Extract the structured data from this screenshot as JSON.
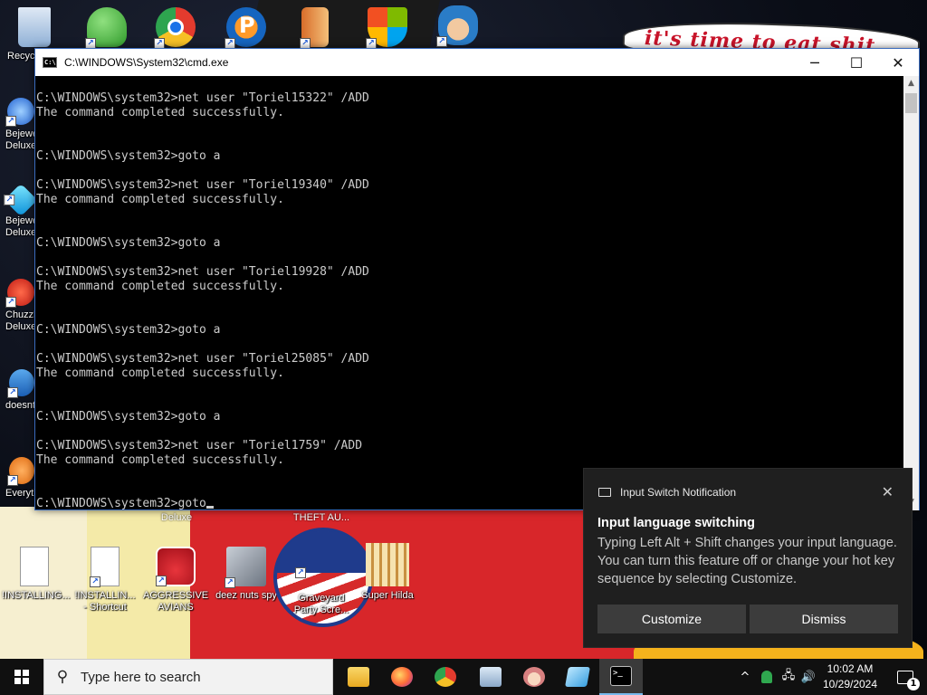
{
  "desktop": {
    "banner_text": "it's time to eat shit",
    "icons": [
      {
        "label": "Recycle Bin",
        "icon": "recycle-bin-icon",
        "color": "#7fa7d8"
      },
      {
        "label": "",
        "icon": "users-icon",
        "color": "#3fae3a"
      },
      {
        "label": "",
        "icon": "chrome-icon",
        "color": "#e33b2e"
      },
      {
        "label": "",
        "icon": "p-app-icon",
        "color": "#1565c0"
      },
      {
        "label": "",
        "icon": "door-icon",
        "color": "#d86d2a"
      },
      {
        "label": "",
        "icon": "shield-icon",
        "color": "#f25022"
      },
      {
        "label": "",
        "icon": "game-character-icon",
        "color": "#2a7cc7"
      },
      {
        "label": "Bejeweled Deluxe",
        "icon": "gem-icon",
        "color": "#1e90ff"
      },
      {
        "label": "Bejeweled Deluxe",
        "icon": "gem-icon",
        "color": "#00bfff"
      },
      {
        "label": "Chuzzle Deluxe",
        "icon": "chuzzle-icon",
        "color": "#e0302a"
      },
      {
        "label": "doesnt",
        "icon": "app-icon",
        "color": "#2d7fd1"
      },
      {
        "label": "Everything",
        "icon": "search-app-icon",
        "color": "#f08a24"
      },
      {
        "label": "!INSTALLING...",
        "icon": "text-file-icon",
        "color": "#ffffff"
      },
      {
        "label": "!INSTALLIN... - Shortcut",
        "icon": "text-file-icon",
        "color": "#ffffff"
      },
      {
        "label": "AGGRESSIVE AVIANS",
        "icon": "angry-bird-icon",
        "color": "#d6202a"
      },
      {
        "label": "deez nuts spy",
        "icon": "stacked-windows-icon",
        "color": "#9aa2ad"
      },
      {
        "label": "Graveyard Party Scre...",
        "icon": "graveyard-icon",
        "color": "#555555"
      },
      {
        "label": "Super Hilda",
        "icon": "pixel-character-icon",
        "color": "#f0c060"
      }
    ],
    "partial_labels": [
      "Deluxe",
      "THEFT AU...",
      "Everything"
    ]
  },
  "cmd_window": {
    "title": "C:\\WINDOWS\\System32\\cmd.exe",
    "minimize": "─",
    "maximize": "☐",
    "close": "✕",
    "lines": [
      "C:\\WINDOWS\\system32>net user \"Toriel15322\" /ADD",
      "The command completed successfully.",
      "",
      "",
      "C:\\WINDOWS\\system32>goto a",
      "",
      "C:\\WINDOWS\\system32>net user \"Toriel19340\" /ADD",
      "The command completed successfully.",
      "",
      "",
      "C:\\WINDOWS\\system32>goto a",
      "",
      "C:\\WINDOWS\\system32>net user \"Toriel19928\" /ADD",
      "The command completed successfully.",
      "",
      "",
      "C:\\WINDOWS\\system32>goto a",
      "",
      "C:\\WINDOWS\\system32>net user \"Toriel25085\" /ADD",
      "The command completed successfully.",
      "",
      "",
      "C:\\WINDOWS\\system32>goto a",
      "",
      "C:\\WINDOWS\\system32>net user \"Toriel1759\" /ADD",
      "The command completed successfully.",
      "",
      "",
      "C:\\WINDOWS\\system32>goto"
    ]
  },
  "notification": {
    "app_name": "Input Switch Notification",
    "heading": "Input language switching",
    "body": "Typing Left Alt + Shift changes your input language. You can turn this feature off or change your hot key sequence by selecting Customize.",
    "close": "✕",
    "customize_label": "Customize",
    "dismiss_label": "Dismiss"
  },
  "taskbar": {
    "search_placeholder": "Type here to search",
    "search_glyph": "⚲",
    "pinned": [
      {
        "name": "file-explorer-icon",
        "color": "#f4c430"
      },
      {
        "name": "firefox-icon",
        "color": "#ff7139"
      },
      {
        "name": "chrome-icon",
        "color": "#e33b2e"
      },
      {
        "name": "network-app-icon",
        "color": "#a8c8e8"
      },
      {
        "name": "anime-character-icon",
        "color": "#e8a0a0"
      },
      {
        "name": "notepad-app-icon",
        "color": "#7cc8f0"
      },
      {
        "name": "cmd-icon",
        "color": "#cccccc"
      }
    ],
    "tray": {
      "chevron": "^",
      "network_glyph": "🖧",
      "volume_glyph": "🔊",
      "time": "10:02 AM",
      "date": "10/29/2024",
      "notification_count": "1"
    }
  }
}
